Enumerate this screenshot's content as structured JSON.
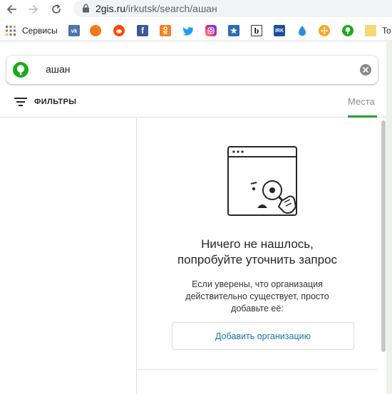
{
  "browser": {
    "url_host": "2gis.ru",
    "url_path": "/irkutsk/search/ашан"
  },
  "bookmarks": {
    "apps_label": "Сервисы",
    "items": [
      {
        "icon": "vk-icon",
        "color": "#4a76a8",
        "glyph": "vk"
      },
      {
        "icon": "pikabu-icon",
        "color": "#f07a1e",
        "glyph": ""
      },
      {
        "icon": "reddit-icon",
        "color": "#ff4500",
        "glyph": ""
      },
      {
        "icon": "facebook-icon",
        "color": "#3b5998",
        "glyph": "f"
      },
      {
        "icon": "odnoklassniki-icon",
        "color": "#f58220",
        "glyph": ""
      },
      {
        "icon": "twitter-icon",
        "color": "#1da1f2",
        "glyph": ""
      },
      {
        "icon": "instagram-icon",
        "color": "#c13584",
        "glyph": ""
      },
      {
        "icon": "bookmark-icon",
        "color": "#2d6db5",
        "glyph": ""
      },
      {
        "icon": "b-icon",
        "color": "#ffffff",
        "glyph": "b"
      },
      {
        "icon": "irk-icon",
        "color": "#1c4f9c",
        "glyph": "IRK"
      },
      {
        "icon": "drop-icon",
        "color": "#2a8fd8",
        "glyph": ""
      },
      {
        "icon": "film-icon",
        "color": "#f5a623",
        "glyph": ""
      },
      {
        "icon": "2gis-icon",
        "color": "#19aa1e",
        "glyph": ""
      },
      {
        "icon": "folder-icon",
        "color": "#f6d776",
        "glyph": ""
      }
    ],
    "last_label": "To"
  },
  "search": {
    "query": "ашан"
  },
  "filters": {
    "label": "ФИЛЬТРЫ",
    "tab_places": "Места"
  },
  "empty_state": {
    "title_line1": "Ничего не нашлось,",
    "title_line2": "попробуйте уточнить запрос",
    "text_line1": "Если уверены, что организация",
    "text_line2": "действительно существует, просто",
    "text_line3": "добавьте её:",
    "add_button": "Добавить организацию"
  },
  "colors": {
    "accent_green": "#26a030",
    "link_blue": "#1a73a8"
  }
}
